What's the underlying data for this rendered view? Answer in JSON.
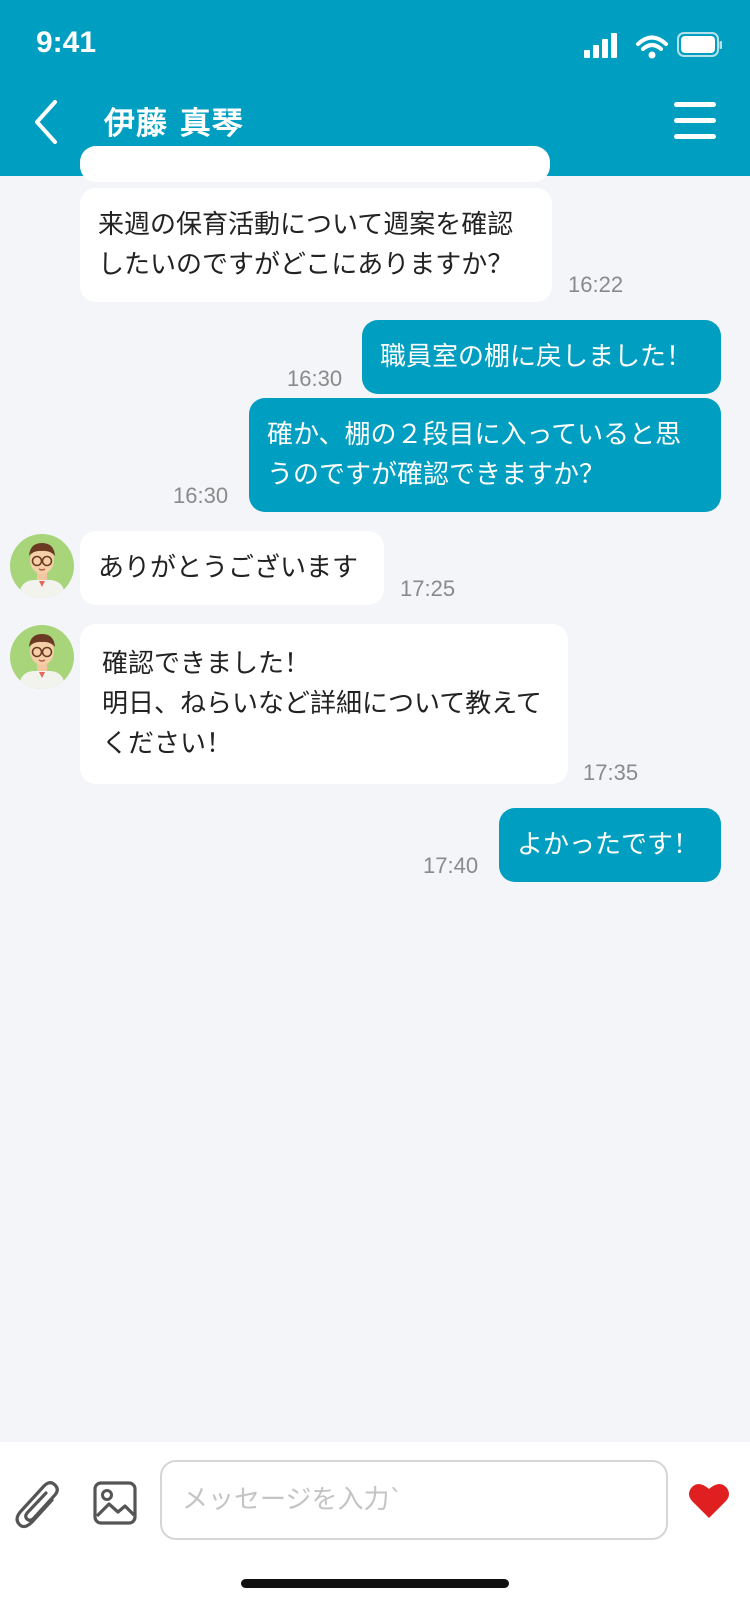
{
  "status_bar": {
    "time": "9:41"
  },
  "header": {
    "title": "伊藤 真琴",
    "back_icon": "chevron-left-icon",
    "menu_icon": "hamburger-menu-icon"
  },
  "messages": [
    {
      "direction": "in",
      "text": "来週の保育活動について週案を確認したいのですがどこにありますか？",
      "time": "16:22",
      "avatar": false
    },
    {
      "direction": "out",
      "text": "職員室の棚に戻しました！",
      "time": "16:30"
    },
    {
      "direction": "out",
      "text": "確か、棚の２段目に入っていると思うのですが確認できますか？",
      "time": "16:30"
    },
    {
      "direction": "in",
      "text": "ありがとうございます",
      "time": "17:25",
      "avatar": true
    },
    {
      "direction": "in",
      "text": "確認できました！\n明日、ねらいなど詳細について教えてください！",
      "time": "17:35",
      "avatar": true
    },
    {
      "direction": "out",
      "text": "よかったです！",
      "time": "17:40"
    }
  ],
  "input_bar": {
    "placeholder": "メッセージを入力`",
    "attach_icon": "paperclip-icon",
    "image_icon": "image-icon",
    "like_icon": "heart-icon"
  },
  "colors": {
    "accent": "#009ec0",
    "background": "#f4f5f9",
    "like": "#e02020"
  }
}
